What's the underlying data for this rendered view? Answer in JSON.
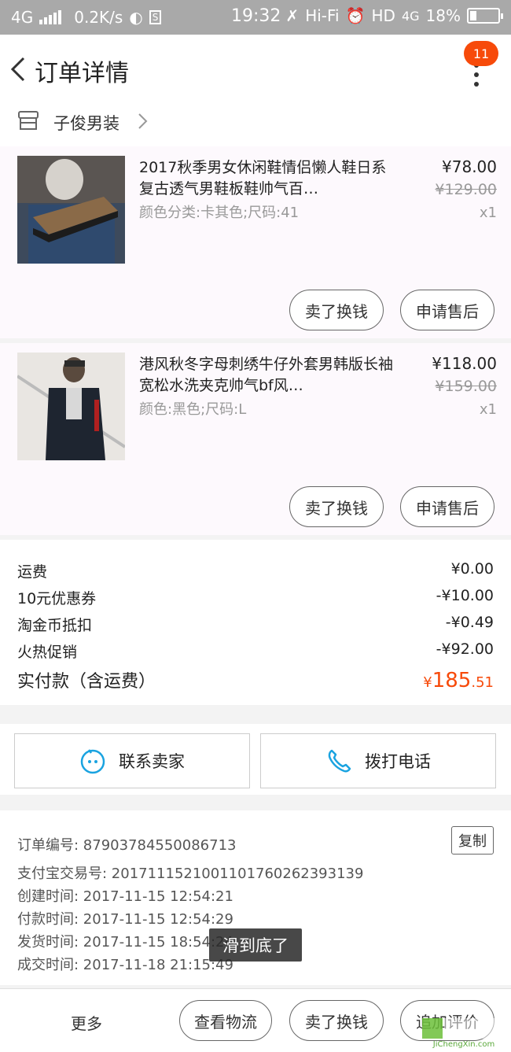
{
  "status_bar": {
    "network": "4G",
    "speed": "0.2K/s",
    "time": "19:32",
    "hifi": "Hi-Fi",
    "hd": "HD",
    "network2": "4G",
    "battery": "18%"
  },
  "header": {
    "title": "订单详情",
    "badge_count": "11"
  },
  "shop": {
    "name": "子俊男装"
  },
  "items": [
    {
      "title": "2017秋季男女休闲鞋情侣懒人鞋日系复古透气男鞋板鞋帅气百…",
      "spec": "颜色分类:卡其色;尺码:41",
      "price": "¥78.00",
      "original_price": "¥129.00",
      "quantity": "x1",
      "btn_sell": "卖了换钱",
      "btn_after_sale": "申请售后"
    },
    {
      "title": "港风秋冬字母刺绣牛仔外套男韩版长袖宽松水洗夹克帅气bf风…",
      "spec": "颜色:黑色;尺码:L",
      "price": "¥118.00",
      "original_price": "¥159.00",
      "quantity": "x1",
      "btn_sell": "卖了换钱",
      "btn_after_sale": "申请售后"
    }
  ],
  "summary": {
    "shipping_label": "运费",
    "shipping_value": "¥0.00",
    "coupon_label": "10元优惠券",
    "coupon_value": "-¥10.00",
    "coins_label": "淘金币抵扣",
    "coins_value": "-¥0.49",
    "promo_label": "火热促销",
    "promo_value": "-¥92.00",
    "total_label": "实付款（含运费）",
    "total_currency": "¥",
    "total_int": "185",
    "total_dec": ".51"
  },
  "contact": {
    "seller_label": "联系卖家",
    "phone_label": "拨打电话"
  },
  "order_info": {
    "order_no": "订单编号: 87903784550086713",
    "alipay_no": "支付宝交易号: 2017111521001101760262393139",
    "created": "创建时间: 2017-11-15 12:54:21",
    "paid": "付款时间: 2017-11-15 12:54:29",
    "shipped": "发货时间: 2017-11-15 18:54:24",
    "completed": "成交时间: 2017-11-18 21:15:49",
    "copy_label": "复制",
    "toast": "滑到底了"
  },
  "bottom_bar": {
    "more_label": "更多",
    "logistics_label": "查看物流",
    "sell_label": "卖了换钱",
    "review_label": "追加评价"
  },
  "watermark": {
    "brand": "JiChengXin.com"
  },
  "colors": {
    "accent_orange": "#f74a0a",
    "icon_blue": "#1aa3e0",
    "status_bar_bg": "#a9a9a9"
  }
}
